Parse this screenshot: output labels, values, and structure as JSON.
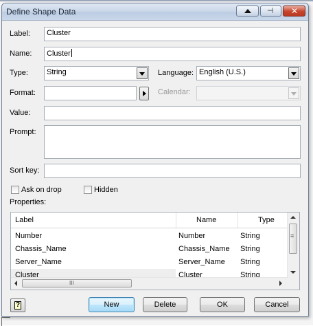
{
  "window": {
    "title": "Define Shape Data"
  },
  "fields": {
    "label": {
      "caption": "Label:",
      "value": "Cluster"
    },
    "name": {
      "caption": "Name:",
      "value": "Cluster"
    },
    "type": {
      "caption": "Type:",
      "value": "String"
    },
    "language": {
      "caption": "Language:",
      "value": "English (U.S.)"
    },
    "format": {
      "caption": "Format:",
      "value": ""
    },
    "calendar": {
      "caption": "Calendar:",
      "value": ""
    },
    "value": {
      "caption": "Value:",
      "value": ""
    },
    "prompt": {
      "caption": "Prompt:",
      "value": ""
    },
    "sort_key": {
      "caption": "Sort key:",
      "value": ""
    }
  },
  "checkboxes": {
    "ask_on_drop": {
      "label": "Ask on drop",
      "checked": false
    },
    "hidden": {
      "label": "Hidden",
      "checked": false
    }
  },
  "properties": {
    "caption": "Properties:",
    "columns": [
      "Label",
      "Name",
      "Type"
    ],
    "rows": [
      [
        "Number",
        "Number",
        "String"
      ],
      [
        "Chassis_Name",
        "Chassis_Name",
        "String"
      ],
      [
        "Server_Name",
        "Server_Name",
        "String"
      ],
      [
        "Cluster",
        "Cluster",
        "String"
      ]
    ],
    "hscroll_glyph": "III",
    "vscroll_glyph": "≡"
  },
  "buttons": {
    "new": "New",
    "delete": "Delete",
    "ok": "OK",
    "cancel": "Cancel",
    "help_glyph": "?"
  },
  "icons": {
    "titlebar": [
      "collapse-up-icon",
      "pin-icon",
      "close-icon"
    ],
    "format_arrow": "right-arrow-icon",
    "help": "help-icon"
  },
  "colors": {
    "titlebar": "#c9d6e7",
    "close_button": "#c6452c",
    "default_button": "#bee6fd",
    "dialog_bg": "#f0f0f0"
  }
}
